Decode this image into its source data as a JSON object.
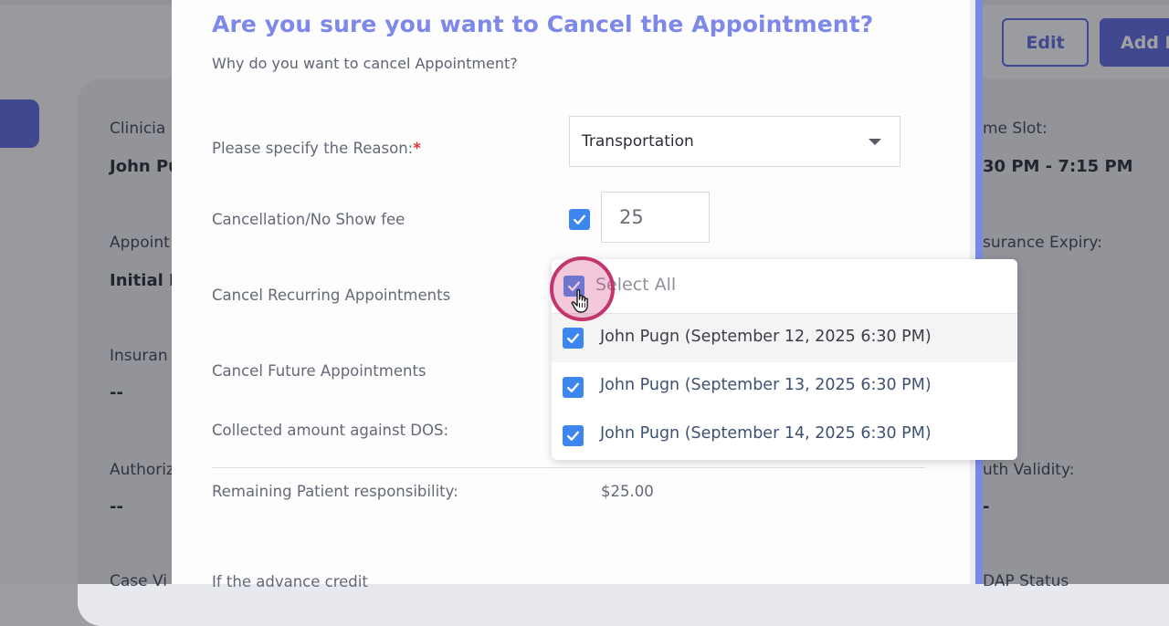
{
  "background": {
    "left_fields": [
      {
        "label": "Clinicia",
        "value": "John Pu"
      },
      {
        "label": "Appoint",
        "value": "Initial E"
      },
      {
        "label": "Insuran",
        "value": "--"
      },
      {
        "label": "Authoriz",
        "value": "--"
      },
      {
        "label": "Case Vi",
        "value": ""
      }
    ],
    "right_fields": [
      {
        "label": "me Slot:",
        "value": "30 PM - 7:15 PM"
      },
      {
        "label": "surance Expiry:",
        "value": ""
      },
      {
        "label": "uth Validity:",
        "value": "-"
      },
      {
        "label": "DAP Status",
        "value": ""
      }
    ],
    "buttons": {
      "edit": "Edit",
      "add": "Add D"
    }
  },
  "modal": {
    "title": "Are you sure you want to Cancel the Appointment?",
    "subtitle": "Why do you want to cancel Appointment?",
    "reason": {
      "label": "Please specify the Reason:",
      "required_mark": "*",
      "selected": "Transportation"
    },
    "fee": {
      "label": "Cancellation/No Show fee",
      "checked": true,
      "value": "25"
    },
    "cancel_recurring": {
      "label": "Cancel Recurring Appointments"
    },
    "cancel_future": {
      "label": "Cancel Future Appointments"
    },
    "collected": {
      "label": "Collected amount against DOS:"
    },
    "remaining": {
      "label": "Remaining Patient responsibility:",
      "value": "$25.00"
    },
    "cut_off_label": "If the advance credit"
  },
  "dropdown": {
    "select_all": {
      "label": "Select All",
      "checked": true
    },
    "items": [
      {
        "label": "John Pugn (September 12, 2025 6:30 PM)",
        "checked": true
      },
      {
        "label": "John Pugn (September 13, 2025 6:30 PM)",
        "checked": true
      },
      {
        "label": "John Pugn (September 14, 2025 6:30 PM)",
        "checked": true
      }
    ]
  },
  "colors": {
    "accent": "#5867dd",
    "title": "#7e88e8",
    "checkbox": "#3d86f0",
    "required": "#e03131",
    "click_ring": "#c2356e"
  },
  "icons": {
    "checkbox": "check-icon",
    "select_caret": "chevron-down-icon",
    "cursor": "hand-pointer-icon"
  }
}
